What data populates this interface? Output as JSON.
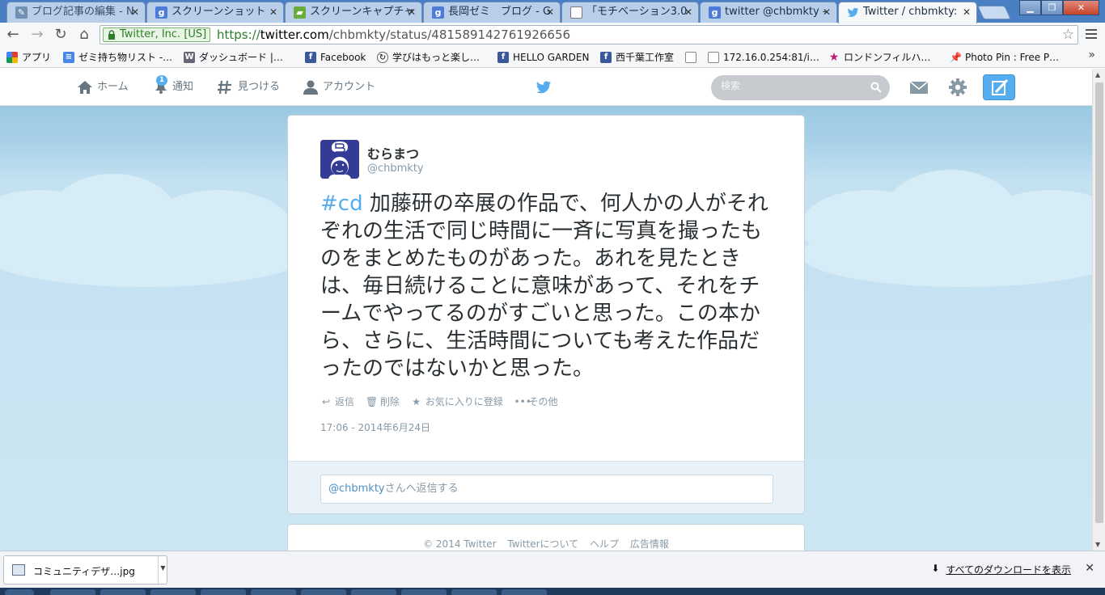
{
  "browser": {
    "tabs": [
      {
        "label": "ブログ記事の編集 - N",
        "icon": "blogger-icon",
        "color": "#6f8fb3"
      },
      {
        "label": "スクリーンショット",
        "icon": "google-icon",
        "color": "#4d7bd8"
      },
      {
        "label": "スクリーンキャプチャ",
        "icon": "feedly-icon",
        "color": "#6aab3a"
      },
      {
        "label": "長岡ゼミ　ブログ - G",
        "icon": "google-icon",
        "color": "#4d7bd8"
      },
      {
        "label": "「モチベーション3.0",
        "icon": "page-icon",
        "color": "#ffffff"
      },
      {
        "label": "twitter @chbmkty -",
        "icon": "google-icon",
        "color": "#4d7bd8"
      },
      {
        "label": "Twitter / chbmkty:",
        "icon": "twitter-bird-icon",
        "color": "#55acee"
      }
    ],
    "ev_label": "Twitter, Inc. [US]",
    "url": {
      "scheme": "https://",
      "host": "twitter.com",
      "path": "/chbmkty/status/481589142761926656"
    },
    "bookmarks": [
      {
        "label": "アプリ",
        "icon": "apps-grid-icon"
      },
      {
        "label": "ゼミ持ち物リスト -…",
        "icon": "docs-icon"
      },
      {
        "label": "ダッシュボード |…",
        "icon": "wordpress-icon"
      },
      {
        "label": "Facebook",
        "icon": "facebook-icon"
      },
      {
        "label": "学びはもっと楽し…",
        "icon": "refresh-icon"
      },
      {
        "label": "HELLO GARDEN",
        "icon": "facebook-icon"
      },
      {
        "label": "西千葉工作室",
        "icon": "facebook-icon"
      },
      {
        "label": "",
        "icon": "page-icon"
      },
      {
        "label": "172.16.0.254:81/i…",
        "icon": "page-icon"
      },
      {
        "label": "ロンドンフィルハ…",
        "icon": "star-icon"
      },
      {
        "label": "Photo Pin : Free P…",
        "icon": "pushpin-icon"
      }
    ],
    "bookmarks_more": "»"
  },
  "twitter": {
    "nav": {
      "home": "ホーム",
      "notifications": "通知",
      "notifications_badge": "1",
      "discover": "見つける",
      "account": "アカウント"
    },
    "search_placeholder": "検索",
    "tweet": {
      "fullname": "むらまつ",
      "screen_name": "@chbmkty",
      "hashtag": "#cd",
      "text": " 加藤研の卒展の作品で、何人かの人がそれぞれの生活で同じ時間に一斉に写真を撮ったものをまとめたものがあった。あれを見たときは、毎日続けることに意味があって、それをチームでやってるのがすごいと思った。この本から、さらに、生活時間についても考えた作品だったのではないかと思った。",
      "actions": {
        "reply": "返信",
        "delete": "削除",
        "favorite": "お気に入りに登録",
        "more": "その他"
      },
      "timestamp": "17:06 - 2014年6月24日",
      "reply_mention": "@chbmkty",
      "reply_suffix": "さんへ返信する"
    },
    "footer": {
      "copyright": "© 2014 Twitter",
      "about": "Twitterについて",
      "help": "ヘルプ",
      "ads": "広告情報"
    }
  },
  "downloads": {
    "file_name": "コミュニティデザ…jpg",
    "show_all": "すべてのダウンロードを表示"
  },
  "colors": {
    "twitter_blue": "#55acee",
    "background_sky": "#a8d1e8",
    "chrome_frame": "#4a7fc3"
  }
}
